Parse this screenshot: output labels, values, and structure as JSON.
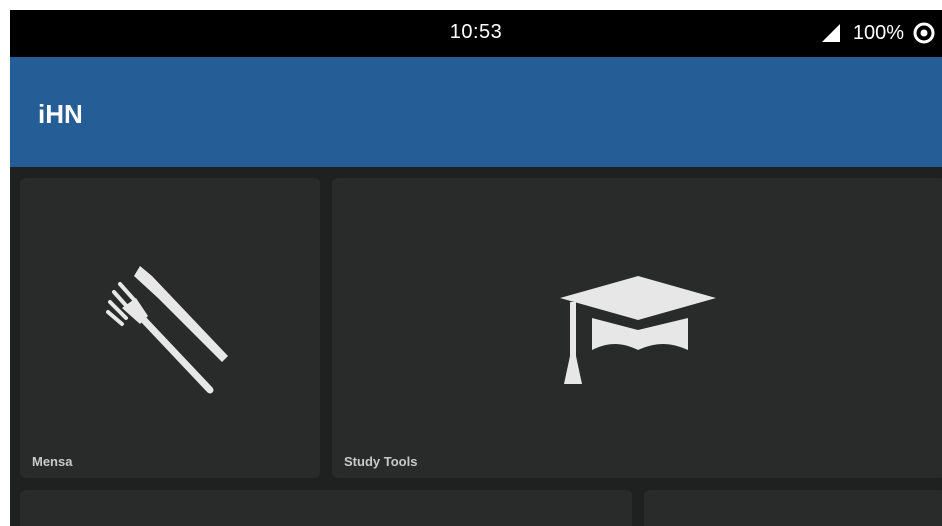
{
  "status_bar": {
    "time": "10:53",
    "battery": "100%",
    "icons": [
      "signal-icon",
      "sync-icon"
    ]
  },
  "app_bar": {
    "title": "iHN",
    "color": "#255e96"
  },
  "tiles": [
    {
      "label": "Mensa",
      "icon": "fork-knife-icon"
    },
    {
      "label": "Study Tools",
      "icon": "graduation-cap-icon"
    },
    {
      "label": "",
      "icon": ""
    },
    {
      "label": "",
      "icon": ""
    }
  ],
  "colors": {
    "background": "#1f2121",
    "tile": "#292b2b",
    "icon": "#e6e7e6",
    "label": "#c8cac9"
  }
}
